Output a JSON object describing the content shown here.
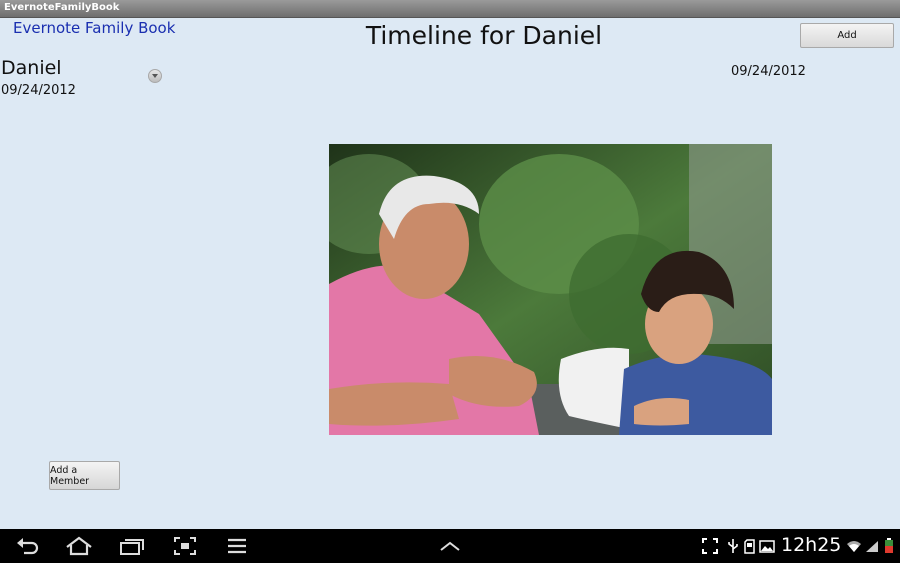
{
  "window": {
    "title": "EvernoteFamilyBook"
  },
  "header": {
    "app_link": "Evernote Family Book",
    "page_title": "Timeline for Daniel",
    "add_label": "Add"
  },
  "sidebar": {
    "member_name": "Daniel",
    "member_date": "09/24/2012",
    "add_member_label": "Add a Member"
  },
  "timeline": {
    "entry_date": "09/24/2012"
  },
  "status_bar": {
    "time": "12h25",
    "icons": [
      "back-icon",
      "home-icon",
      "recent-apps-icon",
      "screenshot-icon",
      "menu-icon",
      "up-arrow-icon",
      "fullscreen-icon",
      "usb-icon",
      "sd-card-icon",
      "gallery-icon",
      "wifi-icon",
      "signal-icon",
      "battery-icon"
    ]
  }
}
